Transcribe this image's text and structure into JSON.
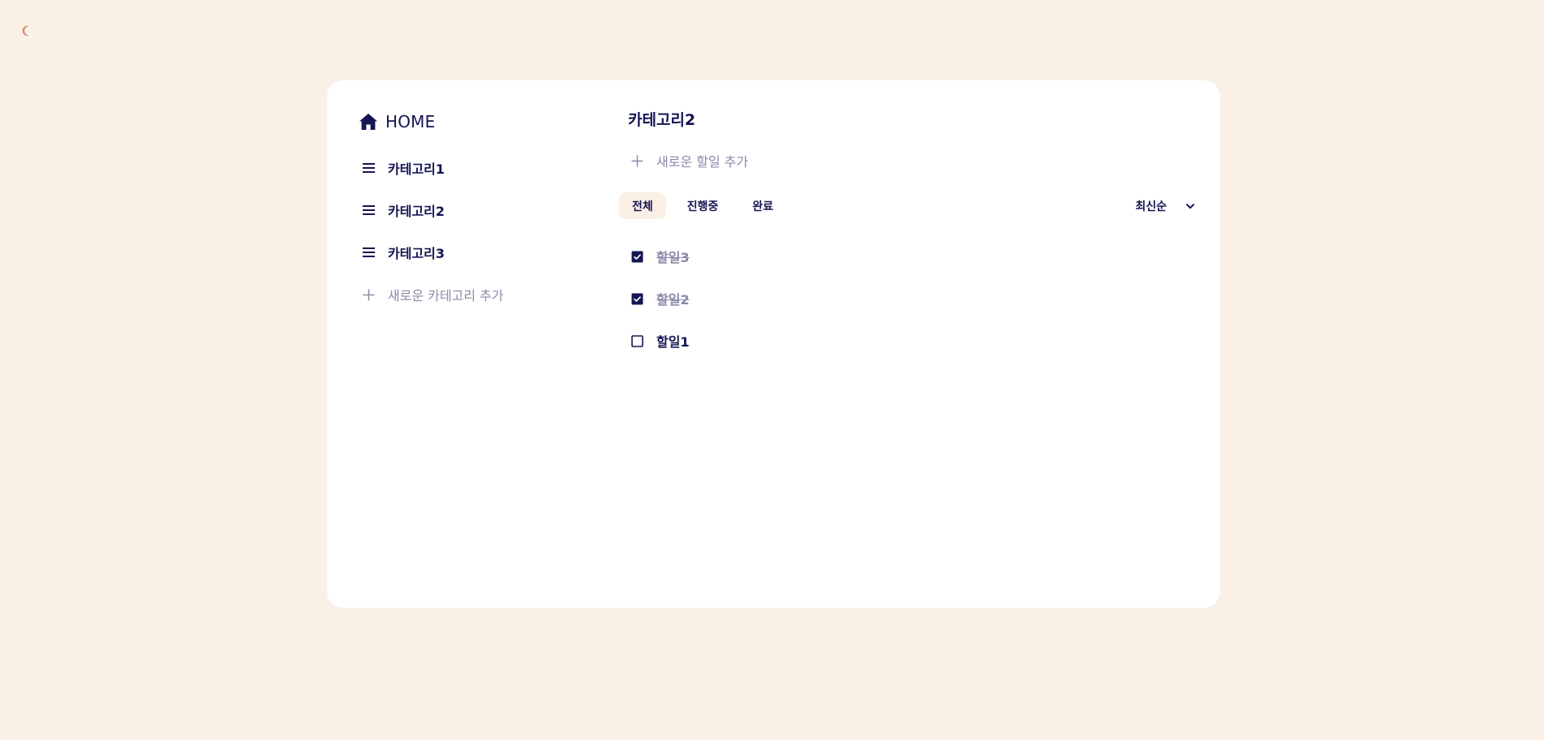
{
  "colors": {
    "background": "#faf0e6",
    "card": "#ffffff",
    "primary": "#141552",
    "muted": "#8a8aa9",
    "moon": "#d38c74"
  },
  "theme_toggle": {
    "icon": "moon-icon"
  },
  "sidebar": {
    "home_icon": "home-icon",
    "home_label": "HOME",
    "categories": [
      {
        "label": "카테고리1",
        "icon": "menu-icon"
      },
      {
        "label": "카테고리2",
        "icon": "menu-icon"
      },
      {
        "label": "카테고리3",
        "icon": "menu-icon"
      }
    ],
    "add_category_label": "새로운 카테고리 추가"
  },
  "main": {
    "title": "카테고리2",
    "add_todo_label": "새로운 할일 추가",
    "filters": [
      {
        "label": "전체",
        "active": true
      },
      {
        "label": "진행중",
        "active": false
      },
      {
        "label": "완료",
        "active": false
      }
    ],
    "sort": {
      "selected": "최신순"
    },
    "todos": [
      {
        "label": "할일3",
        "done": true
      },
      {
        "label": "할일2",
        "done": true
      },
      {
        "label": "할일1",
        "done": false
      }
    ]
  }
}
